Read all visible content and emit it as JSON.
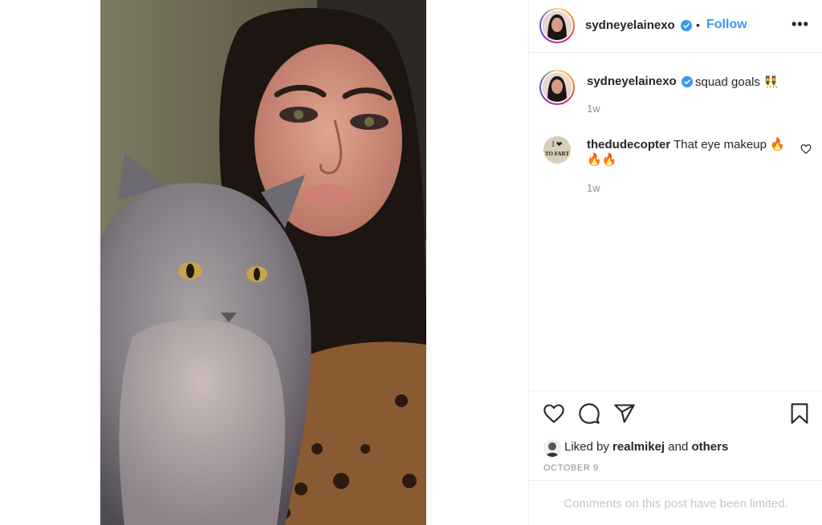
{
  "post": {
    "author": "sydneyelainexo",
    "follow_label": "Follow",
    "separator": "•",
    "more_label": "•••",
    "caption": "squad goals 👯",
    "caption_time": "1w"
  },
  "comments": [
    {
      "user": "thedudecopter",
      "text": "That eye makeup 🔥🔥🔥",
      "time": "1w",
      "avatar_text_top": "I ❤",
      "avatar_text_bottom": "TO FART"
    }
  ],
  "engagement": {
    "liked_prefix": "Liked by ",
    "liked_user": "realmikej",
    "liked_joiner": " and ",
    "liked_others": "others",
    "date": "OCTOBER 9"
  },
  "footer": {
    "limited_text": "Comments on this post have been limited."
  },
  "colors": {
    "accent": "#3897f0",
    "text": "#262626",
    "muted": "#8e8e8e",
    "border": "#efefef"
  },
  "icons": [
    "heart-icon",
    "comment-icon",
    "share-icon",
    "bookmark-icon",
    "verified-badge-icon",
    "more-options-icon"
  ]
}
